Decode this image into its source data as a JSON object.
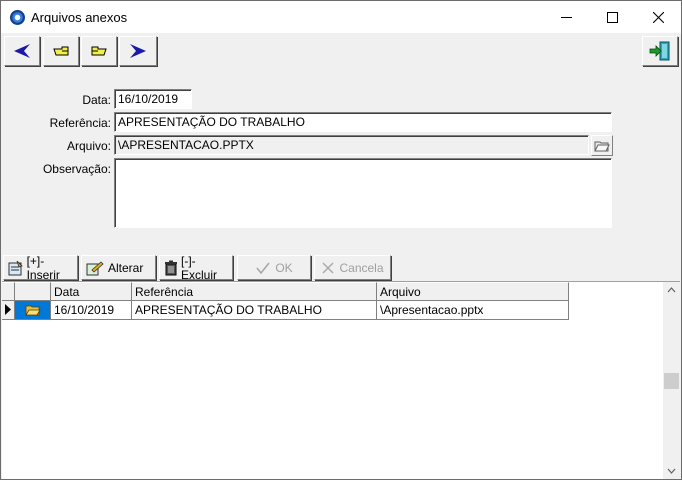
{
  "window": {
    "title": "Arquivos anexos",
    "icon": "app-globe-icon"
  },
  "toolbar": {
    "nav": [
      "first-record-icon",
      "previous-record-icon",
      "next-record-icon",
      "last-record-icon"
    ],
    "exit": "exit-door-icon"
  },
  "form": {
    "data_label": "Data:",
    "data_value": "16/10/2019",
    "referencia_label": "Referência:",
    "referencia_value": "APRESENTAÇÃO DO TRABALHO",
    "arquivo_label": "Arquivo:",
    "arquivo_value": "\\APRESENTACAO.PPTX",
    "observacao_label": "Observação:",
    "observacao_value": ""
  },
  "actions": {
    "inserir": "[+]-Inserir",
    "alterar": "Alterar",
    "excluir": "[-]-Excluir",
    "ok": "OK",
    "cancela": "Cancela"
  },
  "grid": {
    "columns": [
      "Data",
      "Referência",
      "Arquivo"
    ],
    "rows": [
      {
        "data": "16/10/2019",
        "referencia": "APRESENTAÇÃO DO TRABALHO",
        "arquivo": "\\Apresentacao.pptx"
      }
    ]
  },
  "colors": {
    "window_bg": "#f0f0f0",
    "nav_arrow": "#1a1aa8",
    "selected_cell": "#0078d7"
  }
}
